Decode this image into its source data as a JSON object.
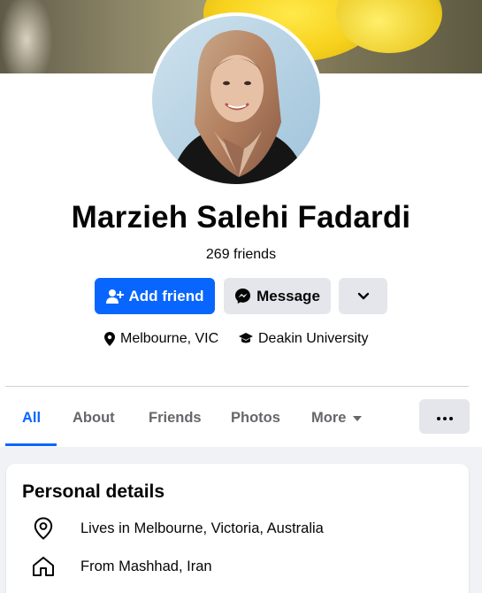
{
  "profile": {
    "name": "Marzieh Salehi Fadardi",
    "friends": "269 friends"
  },
  "actions": {
    "add_friend": "Add friend",
    "message": "Message"
  },
  "meta": {
    "location": "Melbourne, VIC",
    "education": "Deakin University"
  },
  "tabs": [
    {
      "label": "All",
      "active": true
    },
    {
      "label": "About"
    },
    {
      "label": "Friends"
    },
    {
      "label": "Photos"
    },
    {
      "label": "More"
    }
  ],
  "personal": {
    "title": "Personal details",
    "lives": "Lives in Melbourne, Victoria, Australia",
    "from": "From Mashhad, Iran"
  },
  "colors": {
    "accent": "#0866ff",
    "button_gray": "#e4e6eb",
    "page_bg": "#f0f2f5",
    "secondary_text": "#65676b"
  },
  "icons": {
    "add_friend": "person-plus-icon",
    "message": "messenger-icon",
    "dropdown": "chevron-down-icon",
    "location": "map-pin-icon",
    "education": "graduation-cap-icon",
    "tab_more": "caret-down-icon",
    "overflow": "more-dots-icon",
    "lives": "location-outline-icon",
    "from": "home-outline-icon"
  }
}
